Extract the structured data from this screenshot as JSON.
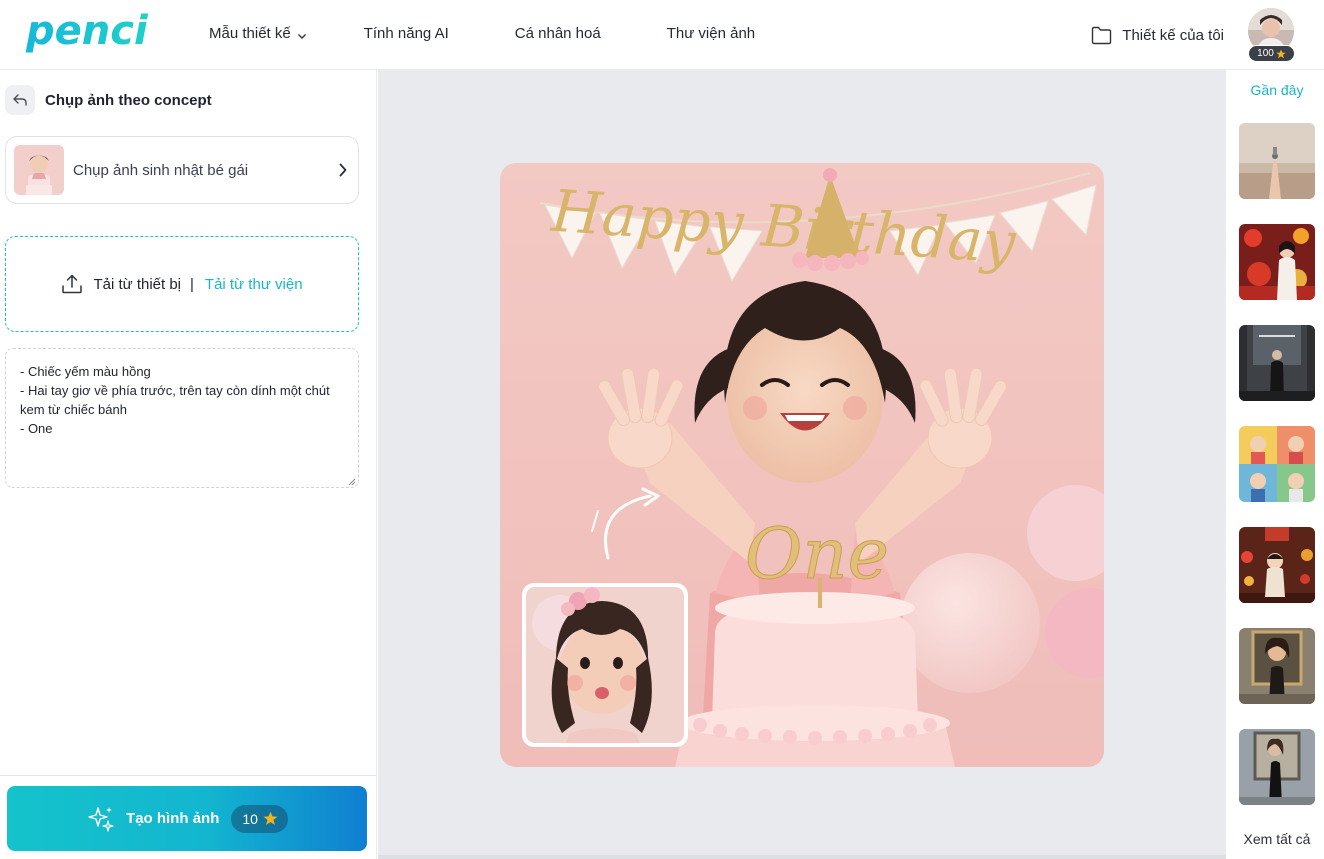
{
  "header": {
    "logo_text": "penci",
    "nav": [
      {
        "label": "Mẫu thiết kế",
        "has_dropdown": true
      },
      {
        "label": "Tính năng AI"
      },
      {
        "label": "Cá nhân hoá"
      },
      {
        "label": "Thư viện ảnh"
      }
    ],
    "my_designs": "Thiết kế của tôi",
    "credits": "100"
  },
  "left_panel": {
    "title": "Chụp ảnh theo concept",
    "concept_label": "Chụp ảnh sinh nhật bé gái",
    "upload_device": "Tải từ thiết bị",
    "upload_separator": "|",
    "upload_library": "Tải từ thư viện",
    "prompt_text": "- Chiếc yếm màu hồng\n- Hai tay giơ về phía trước, trên tay còn dính một chút kem từ chiếc bánh\n- One",
    "generate_label": "Tạo hình ảnh",
    "generate_cost": "10"
  },
  "canvas": {
    "banner_text": "Happy Birthday",
    "topper_text": "One"
  },
  "right_panel": {
    "recent_title": "Gần đây",
    "see_all": "Xem tất cả",
    "thumbnails": [
      "recent-thumb-1",
      "recent-thumb-2",
      "recent-thumb-3",
      "recent-thumb-4",
      "recent-thumb-5",
      "recent-thumb-6",
      "recent-thumb-7"
    ]
  },
  "colors": {
    "accent": "#15b8c4",
    "gen_gradient_start": "#14c3cb",
    "gen_gradient_end": "#0f7fd1",
    "canvas_bg": "#e8eaee",
    "star": "#f5b41e"
  }
}
